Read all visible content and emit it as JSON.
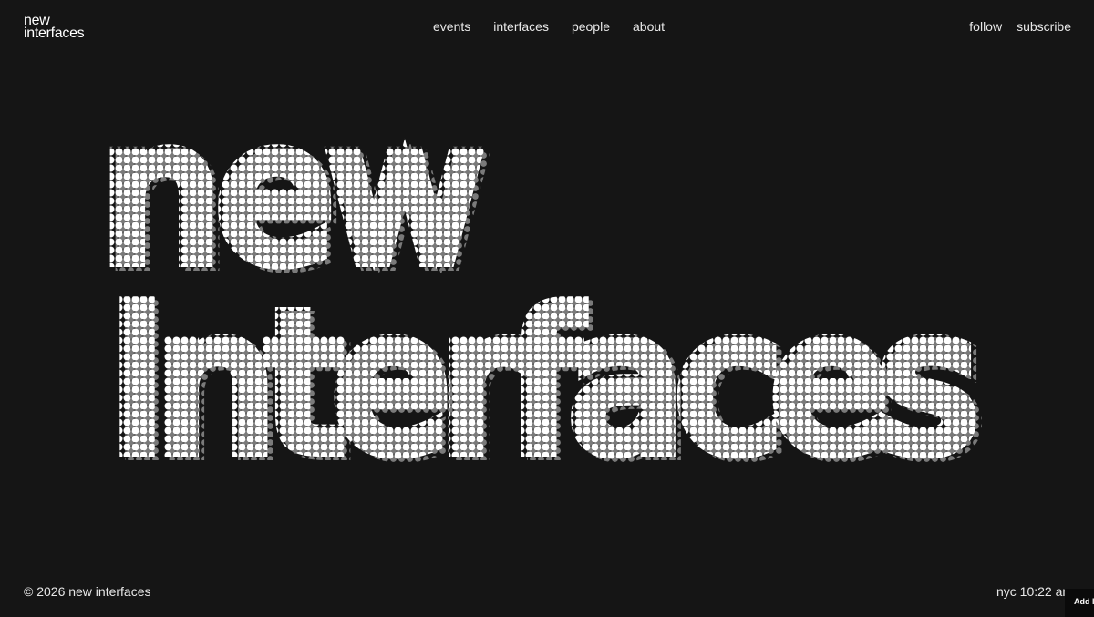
{
  "logo": {
    "line1": "new",
    "line2": "interfaces"
  },
  "nav": {
    "items": [
      {
        "label": "events",
        "name": "nav-events"
      },
      {
        "label": "interfaces",
        "name": "nav-interfaces"
      },
      {
        "label": "people",
        "name": "nav-people"
      },
      {
        "label": "about",
        "name": "nav-about"
      }
    ],
    "right": [
      {
        "label": "follow",
        "name": "nav-follow"
      },
      {
        "label": "subscribe",
        "name": "nav-subscribe"
      }
    ]
  },
  "hero": {
    "line1": "new",
    "line2": "interfaces"
  },
  "footer": {
    "copyright": "© 2026 new interfaces",
    "clock": "nyc 10:22 an"
  },
  "widget": {
    "label": "Add l"
  },
  "colors": {
    "background": "#151515",
    "text": "#ffffff",
    "dot_dim": "#7a7a7a"
  }
}
